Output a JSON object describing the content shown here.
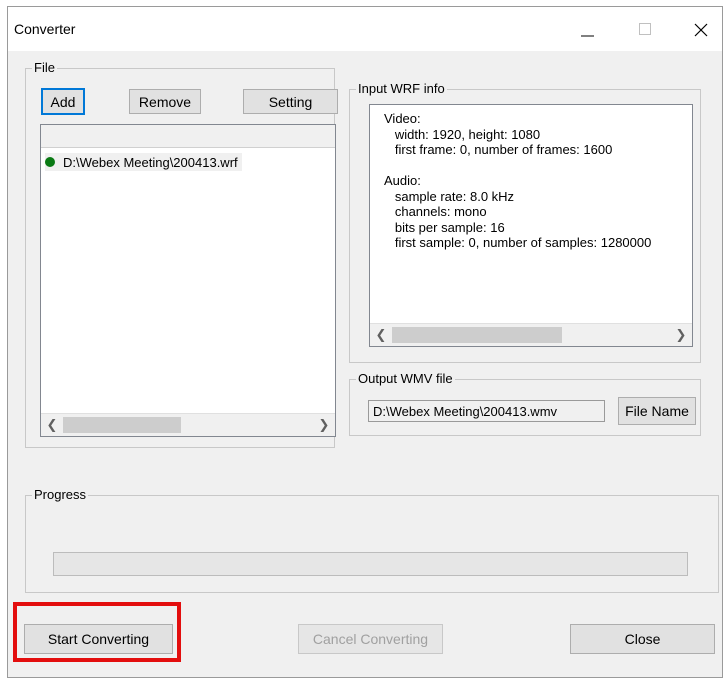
{
  "window": {
    "title": "Converter",
    "controls": {
      "minimize": "minimize-icon",
      "maximize": "maximize-icon",
      "close": "close-icon"
    }
  },
  "file_group": {
    "legend": "File",
    "buttons": {
      "add": "Add",
      "remove": "Remove",
      "setting": "Setting"
    },
    "files": [
      {
        "name": "D:\\Webex Meeting\\200413.wrf",
        "status_color": "#0a7a14"
      }
    ]
  },
  "input_info": {
    "legend": "Input WRF info",
    "text": "Video:\n   width: 1920, height: 1080\n   first frame: 0, number of frames: 1600\n\nAudio:\n   sample rate: 8.0 kHz\n   channels: mono\n   bits per sample: 16\n   first sample: 0, number of samples: 1280000"
  },
  "output_wmv": {
    "legend": "Output WMV file",
    "path": "D:\\Webex Meeting\\200413.wmv",
    "file_name_button": "File Name"
  },
  "progress": {
    "legend": "Progress",
    "value": 0
  },
  "footer": {
    "start": "Start Converting",
    "cancel": "Cancel Converting",
    "close": "Close"
  },
  "colors": {
    "highlight": "#e30e0e",
    "default_button_border": "#0078d7",
    "window_bg": "#f0f0f0"
  }
}
